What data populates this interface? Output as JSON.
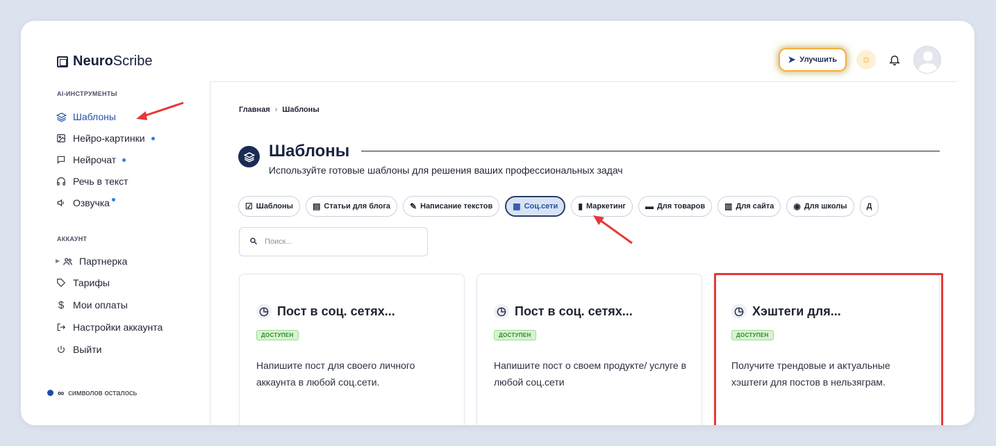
{
  "brand": {
    "bold": "Neuro",
    "regular": "Scribe"
  },
  "header": {
    "upgrade_label": "Улучшить"
  },
  "sidebar": {
    "ai_section": "AI-ИНСТРУМЕНТЫ",
    "ai_items": [
      {
        "label": "Шаблоны",
        "icon": "layers-icon",
        "dot": false
      },
      {
        "label": "Нейро-картинки",
        "icon": "image-icon",
        "dot": true
      },
      {
        "label": "Нейрочат",
        "icon": "chat-icon",
        "dot": true
      },
      {
        "label": "Речь в текст",
        "icon": "headphones-icon",
        "dot": false
      },
      {
        "label": "Озвучка",
        "icon": "speaker-icon",
        "dot": true
      }
    ],
    "account_section": "АККАУНТ",
    "account_items": [
      {
        "label": "Партнерка",
        "icon": "users-icon"
      },
      {
        "label": "Тарифы",
        "icon": "tag-icon"
      },
      {
        "label": "Мои оплаты",
        "icon": "dollar-icon"
      },
      {
        "label": "Настройки аккаунта",
        "icon": "exit-arrow-icon"
      },
      {
        "label": "Выйти",
        "icon": "power-icon"
      }
    ],
    "symbols": {
      "value": "∞",
      "label": "символов осталось"
    }
  },
  "breadcrumb": {
    "home": "Главная",
    "separator": "›",
    "current": "Шаблоны"
  },
  "page": {
    "title": "Шаблоны",
    "subtitle": "Используйте готовые шаблоны для решения ваших профессиональных задач"
  },
  "chips": [
    {
      "emoji": "☑",
      "label": "Шаблоны"
    },
    {
      "emoji": "▤",
      "label": "Статьи для блога"
    },
    {
      "emoji": "✎",
      "label": "Написание текстов"
    },
    {
      "emoji": "▦",
      "label": "Соц.сети",
      "active": true
    },
    {
      "emoji": "▮",
      "label": "Маркетинг"
    },
    {
      "emoji": "▬",
      "label": "Для товаров"
    },
    {
      "emoji": "▥",
      "label": "Для сайта"
    },
    {
      "emoji": "◉",
      "label": "Для школы"
    },
    {
      "emoji": "",
      "label": "Д"
    }
  ],
  "search": {
    "placeholder": "Поиск..."
  },
  "cards": [
    {
      "title": "Пост в соц. сетях...",
      "badge": "ДОСТУПЕН",
      "desc": "Напишите пост для своего личного аккаунта в любой соц.сети."
    },
    {
      "title": "Пост в соц. сетях...",
      "badge": "ДОСТУПЕН",
      "desc": "Напишите пост о своем продукте/ услуге в любой соц.сети"
    },
    {
      "title": "Хэштеги для...",
      "badge": "ДОСТУПЕН",
      "desc": "Получите трендовые и актуальные хэштеги для постов в нельзяграм."
    }
  ],
  "colors": {
    "accent": "#2450a8",
    "dark": "#1a2c54",
    "highlight": "#e53935",
    "badge_bg": "#d8f2d2"
  }
}
